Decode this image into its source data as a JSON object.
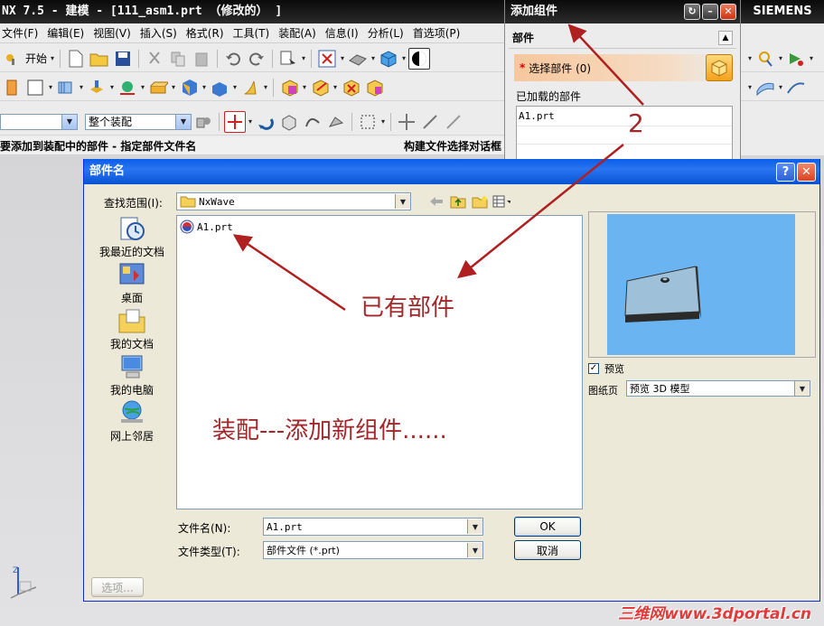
{
  "nx": {
    "title": "NX 7.5 - 建模 - [111_asm1.prt （修改的） ]",
    "brand": "SIEMENS",
    "menu": [
      "文件(F)",
      "编辑(E)",
      "视图(V)",
      "插入(S)",
      "格式(R)",
      "工具(T)",
      "装配(A)",
      "信息(I)",
      "分析(L)",
      "首选项(P)"
    ],
    "start_label": "开始",
    "filter_value": "",
    "assembly_scope": "整个装配",
    "cue": "要添加到装配中的部件 - 指定部件文件名",
    "status": "构建文件选择对话框"
  },
  "add_component": {
    "title": "添加组件",
    "section": "部件",
    "select_part": "选择部件 (0)",
    "loaded_label": "已加载的部件",
    "loaded_parts": [
      "A1.prt"
    ]
  },
  "dialog": {
    "title": "部件名",
    "look_in_label": "查找范围(I):",
    "look_in_value": "NxWave",
    "places": [
      {
        "label": "我最近的文档",
        "icon": "recent-documents-icon"
      },
      {
        "label": "桌面",
        "icon": "desktop-icon"
      },
      {
        "label": "我的文档",
        "icon": "my-documents-icon"
      },
      {
        "label": "我的电脑",
        "icon": "my-computer-icon"
      },
      {
        "label": "网上邻居",
        "icon": "network-places-icon"
      }
    ],
    "files": [
      "A1.prt"
    ],
    "preview_label": "预览",
    "preview_checked": true,
    "sheet_label": "图纸页",
    "sheet_value": "预览 3D 模型",
    "file_name_label": "文件名(N):",
    "file_name_value": "A1.prt",
    "file_type_label": "文件类型(T):",
    "file_type_value": "部件文件 (*.prt)",
    "ok": "OK",
    "cancel": "取消",
    "options": "选项..."
  },
  "annotations": {
    "existing_part": "已有部件",
    "assembly_note": "装配---添加新组件......",
    "step": "2",
    "color": "#a0282a"
  },
  "watermark": "三维网www.3dportal.cn"
}
